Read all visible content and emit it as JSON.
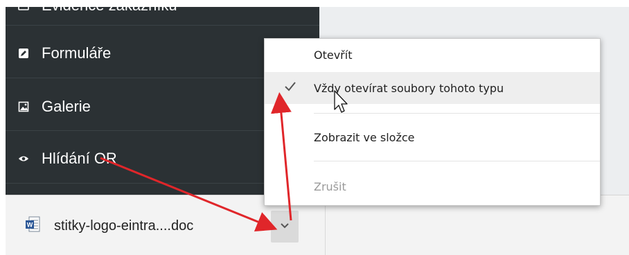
{
  "sidebar": {
    "items": [
      {
        "label": "Evidence zákazníků",
        "icon": "list-icon"
      },
      {
        "label": "Formuláře",
        "icon": "edit-icon"
      },
      {
        "label": "Galerie",
        "icon": "image-icon"
      },
      {
        "label": "Hlídání OR",
        "icon": "eye-icon"
      }
    ]
  },
  "download_bar": {
    "file_name": "stitky-logo-eintra....doc",
    "file_icon": "word-document-icon",
    "chevron_icon": "chevron-down-icon"
  },
  "context_menu": {
    "items": [
      {
        "label": "Otevřít",
        "checked": false,
        "disabled": false
      },
      {
        "label": "Vždy otevírat soubory tohoto typu",
        "checked": true,
        "disabled": false,
        "highlighted": true
      },
      {
        "label": "Zobrazit ve složce",
        "checked": false,
        "disabled": false
      },
      {
        "label": "Zrušit",
        "checked": false,
        "disabled": true
      }
    ]
  },
  "colors": {
    "sidebar_bg": "#2b3134",
    "annotation_arrow": "#e0262a",
    "menu_highlight": "#eeeeee"
  }
}
